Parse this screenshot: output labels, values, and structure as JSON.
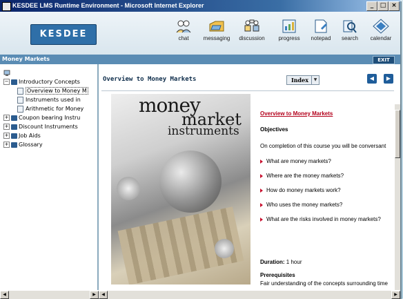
{
  "window": {
    "title": "KESDEE LMS Runtime Environment - Microsoft Internet Explorer",
    "controls": {
      "minimize": "_",
      "maximize": "□",
      "close": "×"
    }
  },
  "header": {
    "logo": "KESDEE",
    "nav": [
      {
        "label": "chat",
        "icon": "chat-icon"
      },
      {
        "label": "messaging",
        "icon": "messaging-icon"
      },
      {
        "label": "discussion",
        "icon": "discussion-icon"
      },
      {
        "label": "progress",
        "icon": "progress-icon"
      },
      {
        "label": "notepad",
        "icon": "notepad-icon"
      },
      {
        "label": "search",
        "icon": "search-icon"
      },
      {
        "label": "calendar",
        "icon": "calendar-icon"
      }
    ]
  },
  "section": {
    "title": "Money Markets",
    "exit_label": "EXIT"
  },
  "sidebar": {
    "tree": [
      {
        "label": "Introductory Concepts",
        "expander": "−",
        "level": 0
      },
      {
        "label": "Overview to Money M",
        "level": 1
      },
      {
        "label": "Instruments used in",
        "level": 1
      },
      {
        "label": "Arithmetic for Money",
        "level": 1
      },
      {
        "label": "Coupon bearing Instru",
        "expander": "+",
        "level": 0
      },
      {
        "label": "Discount Instruments",
        "expander": "+",
        "level": 0
      },
      {
        "label": "Job Aids",
        "expander": "+",
        "level": 0
      },
      {
        "label": "Glossary",
        "expander": "+",
        "level": 0
      }
    ]
  },
  "content": {
    "title": "Overview to Money Markets",
    "index_label": "Index",
    "prev_symbol": "◀",
    "next_symbol": "▶",
    "cover": {
      "line1": "money",
      "line2": "market",
      "line3": "instruments"
    },
    "heading": "Overview to Money Markets",
    "objectives_label": "Objectives",
    "intro": "On completion of this course you will be conversant",
    "objectives": [
      "What are money markets?",
      "Where are the money markets?",
      "How do money markets work?",
      "Who uses the money markets?",
      "What are the risks involved in money markets?"
    ],
    "duration_label": "Duration:",
    "duration_value": "1 hour",
    "prerequisites_label": "Prerequisites",
    "prerequisites_text": "Fair understanding of the concepts surrounding time"
  },
  "colors": {
    "accent": "#c8102e",
    "section_bar": "#5a8cb4",
    "title_bar": "#0a246a"
  }
}
